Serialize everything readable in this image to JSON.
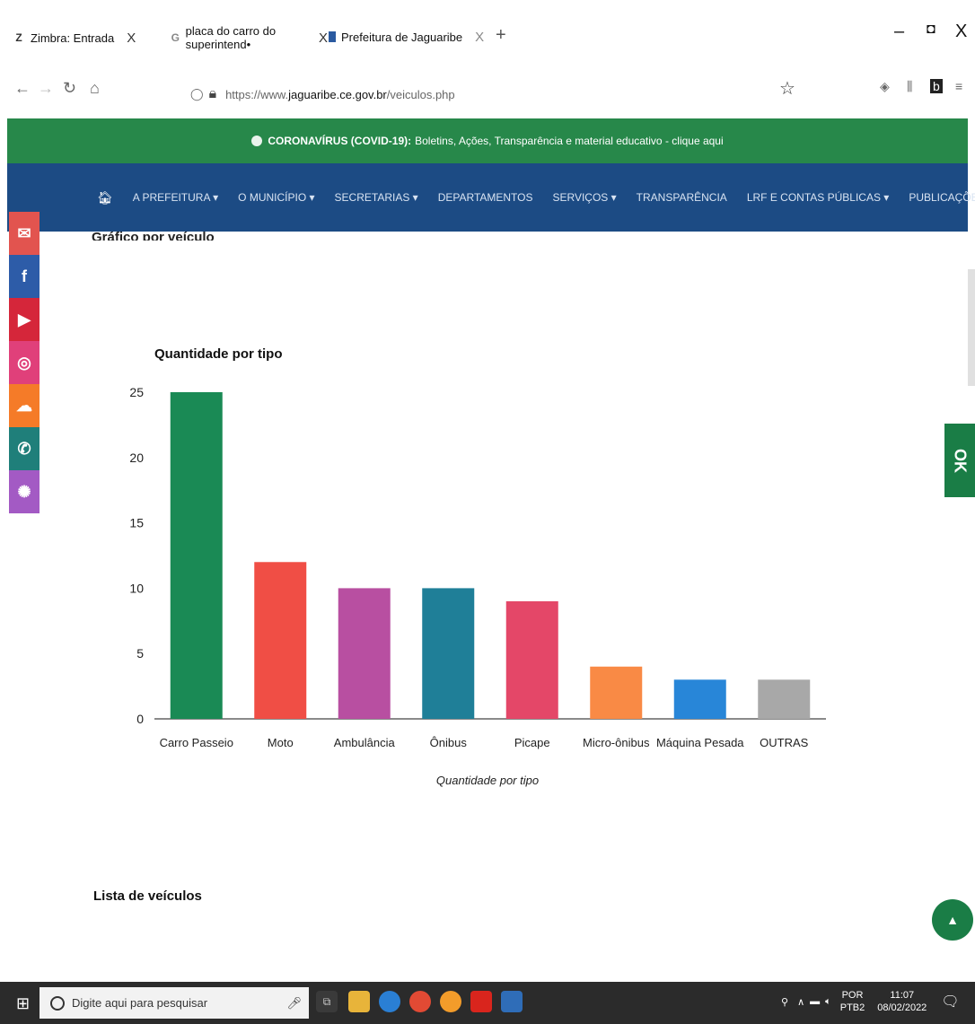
{
  "browser": {
    "tabs": [
      {
        "label": "Zimbra: Entrada",
        "icon": "zimbra-icon"
      },
      {
        "label": "placa do carro do superintend•",
        "icon": "google-icon"
      },
      {
        "label": "Prefeitura de Jaguaribe",
        "icon": "site-icon"
      }
    ],
    "new_tab": "+",
    "url_prefix": "https://www.",
    "url_host": "jaguaribe.ce.gov.br",
    "url_path": "/veiculos.php"
  },
  "covid_banner": {
    "bold": "CORONAVÍRUS (COVID-19):",
    "text": "Boletins, Ações, Transparência e material educativo - clique aqui"
  },
  "menu": {
    "items": [
      "A PREFEITURA",
      "O MUNICÍPIO",
      "SECRETARIAS",
      "DEPARTAMENTOS",
      "SERVIÇOS",
      "TRANSPARÊNCIA",
      "LRF E CONTAS PÚBLICAS",
      "PUBLICAÇÕES"
    ],
    "dropdown": [
      true,
      true,
      true,
      false,
      true,
      false,
      true,
      true
    ]
  },
  "section_heading": "Gráfico por veículo",
  "list_heading": "Lista de veículos",
  "chart_data": {
    "type": "bar",
    "title": "Quantidade por tipo",
    "xlabel": "Quantidade por tipo",
    "ylabel": "",
    "categories": [
      "Carro Passeio",
      "Moto",
      "Ambulância",
      "Ônibus",
      "Picape",
      "Micro-ônibus",
      "Máquina Pesada",
      "OUTRAS"
    ],
    "values": [
      25,
      12,
      10,
      10,
      9,
      4,
      3,
      3
    ],
    "colors": [
      "#1a8a55",
      "#f04e45",
      "#b84fa1",
      "#1f7f98",
      "#e44768",
      "#f98a45",
      "#2886d8",
      "#a8a8a8"
    ],
    "ylim": [
      0,
      25
    ],
    "yticks": [
      0,
      5,
      10,
      15,
      20,
      25
    ],
    "grid": false,
    "legend": "none"
  },
  "taskbar": {
    "search_placeholder": "Digite aqui para pesquisar",
    "lang_top": "POR",
    "lang_bottom": "PTB2",
    "time": "11:07",
    "date": "08/02/2022"
  },
  "colors": {
    "covid_green": "#27884a",
    "menu_blue": "#1c4b84",
    "widget_green": "#1a7d46"
  }
}
